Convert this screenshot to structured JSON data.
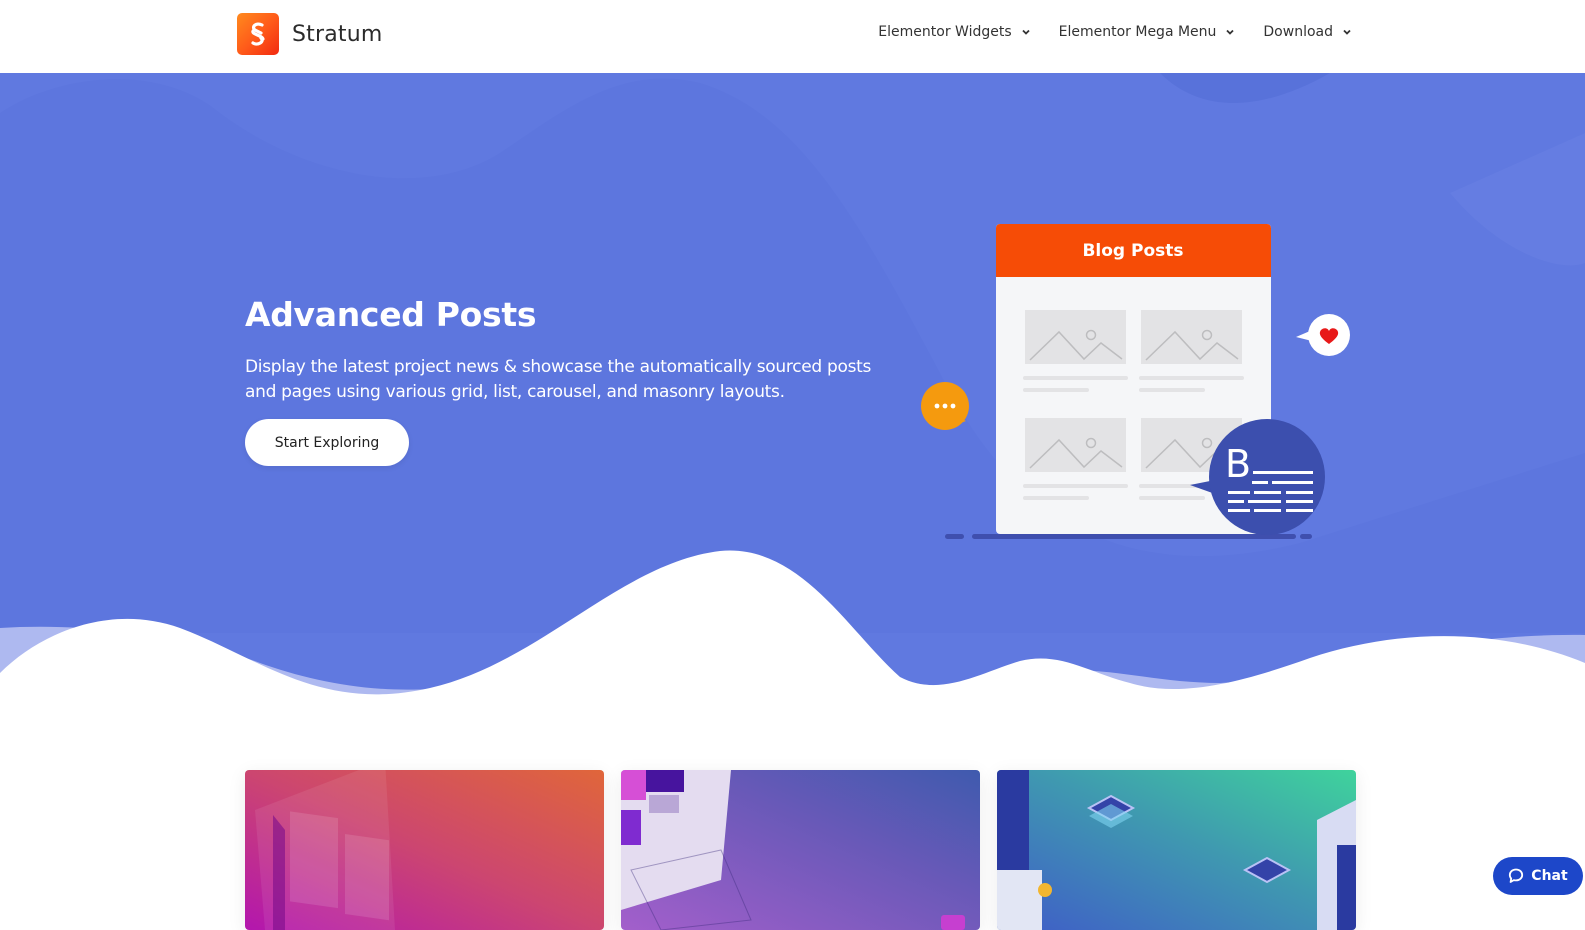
{
  "brand": {
    "name": "Stratum",
    "logo_icon": "stratum-s-logo-icon",
    "logo_gradient": [
      "#ff8a1e",
      "#f22a10"
    ]
  },
  "nav": {
    "items": [
      {
        "label": "Elementor Widgets",
        "icon": "chevron-down-icon"
      },
      {
        "label": "Elementor Mega Menu",
        "icon": "chevron-down-icon"
      },
      {
        "label": "Download",
        "icon": "chevron-down-icon"
      }
    ]
  },
  "hero": {
    "title": "Advanced Posts",
    "description": "Display the latest project news & showcase the automatically sourced posts and pages using various grid, list, carousel, and masonry layouts.",
    "cta_label": "Start Exploring",
    "background_color": "#6079e0",
    "wave_light_color": "#aeb9f0",
    "illustration": {
      "panel_title": "Blog Posts",
      "panel_header_color": "#f64c06",
      "chat_bubble_icon": "ellipsis-bubble-icon",
      "heart_bubble_icon": "heart-bubble-icon",
      "blog_badge_icon": "blog-text-icon",
      "blog_badge_letter": "B"
    }
  },
  "cards": [
    {
      "name": "web-design-card",
      "gradient": [
        "#b316ae",
        "#e0663a"
      ]
    },
    {
      "name": "mobile-analytics-card",
      "gradient": [
        "#9a5cc8",
        "#3f5bb0"
      ]
    },
    {
      "name": "server-network-card",
      "gradient": [
        "#3f62c8",
        "#3fd39c"
      ]
    }
  ],
  "chat": {
    "label": "Chat",
    "icon": "chat-bubble-icon",
    "color": "#1d47c9"
  }
}
